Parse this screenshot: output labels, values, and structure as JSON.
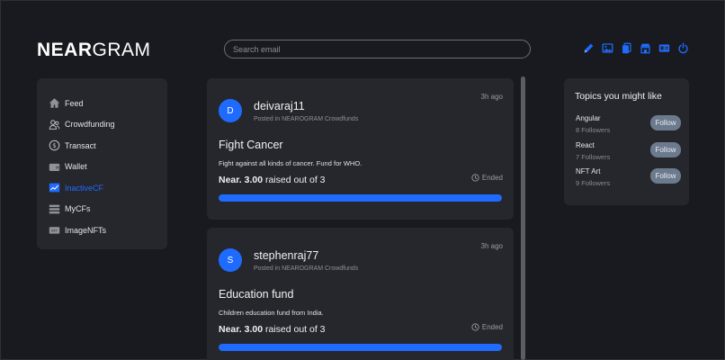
{
  "brand": {
    "logo_bold": "NEAR",
    "logo_light": "GRAM"
  },
  "search": {
    "placeholder": "Search email"
  },
  "header_icons": [
    "pencil-icon",
    "image-icon",
    "copy-icon",
    "store-icon",
    "id-card-icon",
    "power-icon"
  ],
  "colors": {
    "background": "#181a1f",
    "panel": "#25272c",
    "accent": "#1f6bff",
    "follow_button": "#6c7a8d"
  },
  "sidebar": {
    "items": [
      {
        "label": "Feed",
        "icon": "home-icon"
      },
      {
        "label": "Crowdfunding",
        "icon": "people-icon"
      },
      {
        "label": "Transact",
        "icon": "dollar-icon"
      },
      {
        "label": "Wallet",
        "icon": "wallet-icon"
      },
      {
        "label": "InactiveCF",
        "icon": "chart-icon",
        "active": true
      },
      {
        "label": "MyCFs",
        "icon": "list-icon"
      },
      {
        "label": "ImageNFTs",
        "icon": "nft-icon"
      }
    ]
  },
  "feed": {
    "posts": [
      {
        "avatar": "D",
        "username": "deivaraj11",
        "posted_in": "Posted in NEAROGRAM Crowdfunds",
        "time": "3h ago",
        "title": "Fight Cancer",
        "description": "Fight against all kinds of cancer. Fund for WHO.",
        "status": "Ended",
        "raised_bold": "Near. 3.00",
        "raised_rest": " raised out of 3",
        "progress": 1.0
      },
      {
        "avatar": "S",
        "username": "stephenraj77",
        "posted_in": "Posted in NEAROGRAM Crowdfunds",
        "time": "3h ago",
        "title": "Education fund",
        "description": "Children education fund from India.",
        "status": "Ended",
        "raised_bold": "Near. 3.00",
        "raised_rest": " raised out of 3",
        "progress": 1.0
      }
    ]
  },
  "topics": {
    "heading": "Topics you might like",
    "items": [
      {
        "name": "Angular",
        "followers": "8 Followers",
        "button": "Follow"
      },
      {
        "name": "React",
        "followers": "7 Followers",
        "button": "Follow"
      },
      {
        "name": "NFT Art",
        "followers": "9 Followers",
        "button": "Follow"
      }
    ]
  }
}
